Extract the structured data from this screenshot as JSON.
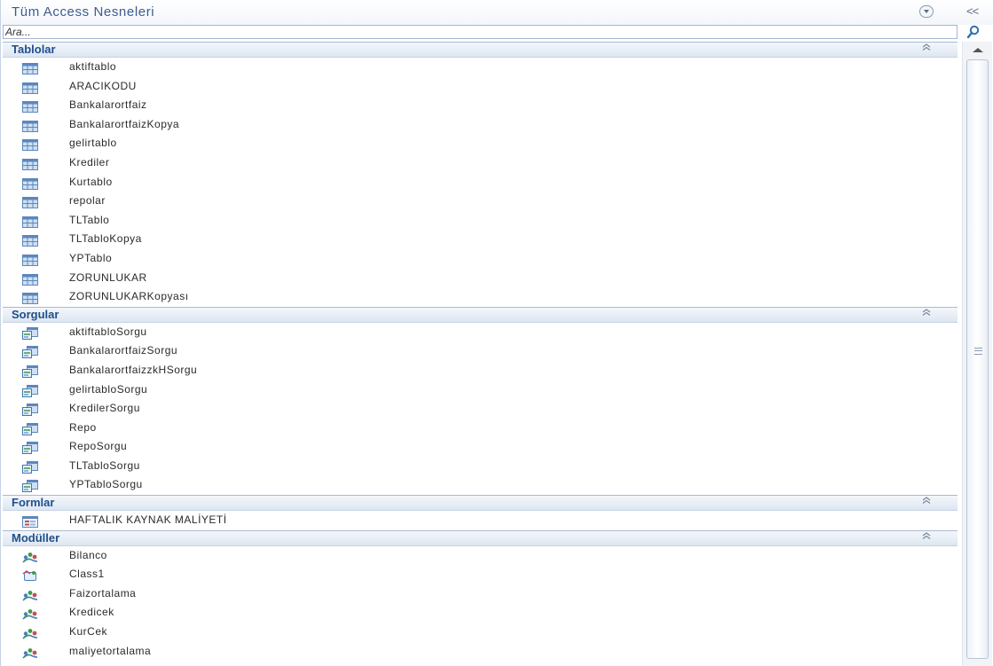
{
  "pane": {
    "title": "Tüm Access Nesneleri",
    "menu_icon": "dropdown-circle-icon",
    "collapse_label": "<<",
    "search_placeholder": "Ara...",
    "search_icon": "magnifier-icon"
  },
  "groups": [
    {
      "key": "tables",
      "label": "Tablolar",
      "icon": "table-icon",
      "items": [
        "aktiftablo",
        "ARACIKODU",
        "Bankalarortfaiz",
        "BankalarortfaizKopya",
        "gelirtablo",
        "Krediler",
        "Kurtablo",
        "repolar",
        "TLTablo",
        "TLTabloKopya",
        "YPTablo",
        "ZORUNLUKAR",
        "ZORUNLUKARKopyası"
      ]
    },
    {
      "key": "queries",
      "label": "Sorgular",
      "icon": "query-icon",
      "items": [
        "aktiftabloSorgu",
        "BankalarortfaizSorgu",
        "BankalarortfaizzkHSorgu",
        "gelirtabloSorgu",
        "KredilerSorgu",
        "Repo",
        "RepoSorgu",
        "TLTabloSorgu",
        "YPTabloSorgu"
      ]
    },
    {
      "key": "forms",
      "label": "Formlar",
      "icon": "form-icon",
      "items": [
        "HAFTALIK KAYNAK MALİYETİ"
      ]
    },
    {
      "key": "modules",
      "label": "Modüller",
      "icon": "module-icon",
      "items": [
        {
          "label": "Bilanco",
          "icon": "module-icon"
        },
        {
          "label": "Class1",
          "icon": "class-module-icon"
        },
        {
          "label": "Faizortalama",
          "icon": "module-icon"
        },
        {
          "label": "Kredicek",
          "icon": "module-icon"
        },
        {
          "label": "KurCek",
          "icon": "module-icon"
        },
        {
          "label": "maliyetortalama",
          "icon": "module-icon"
        }
      ]
    }
  ],
  "colors": {
    "header_text": "#1f4f8c",
    "title_text": "#3b5d8e",
    "header_bg": "#dde6f1"
  }
}
